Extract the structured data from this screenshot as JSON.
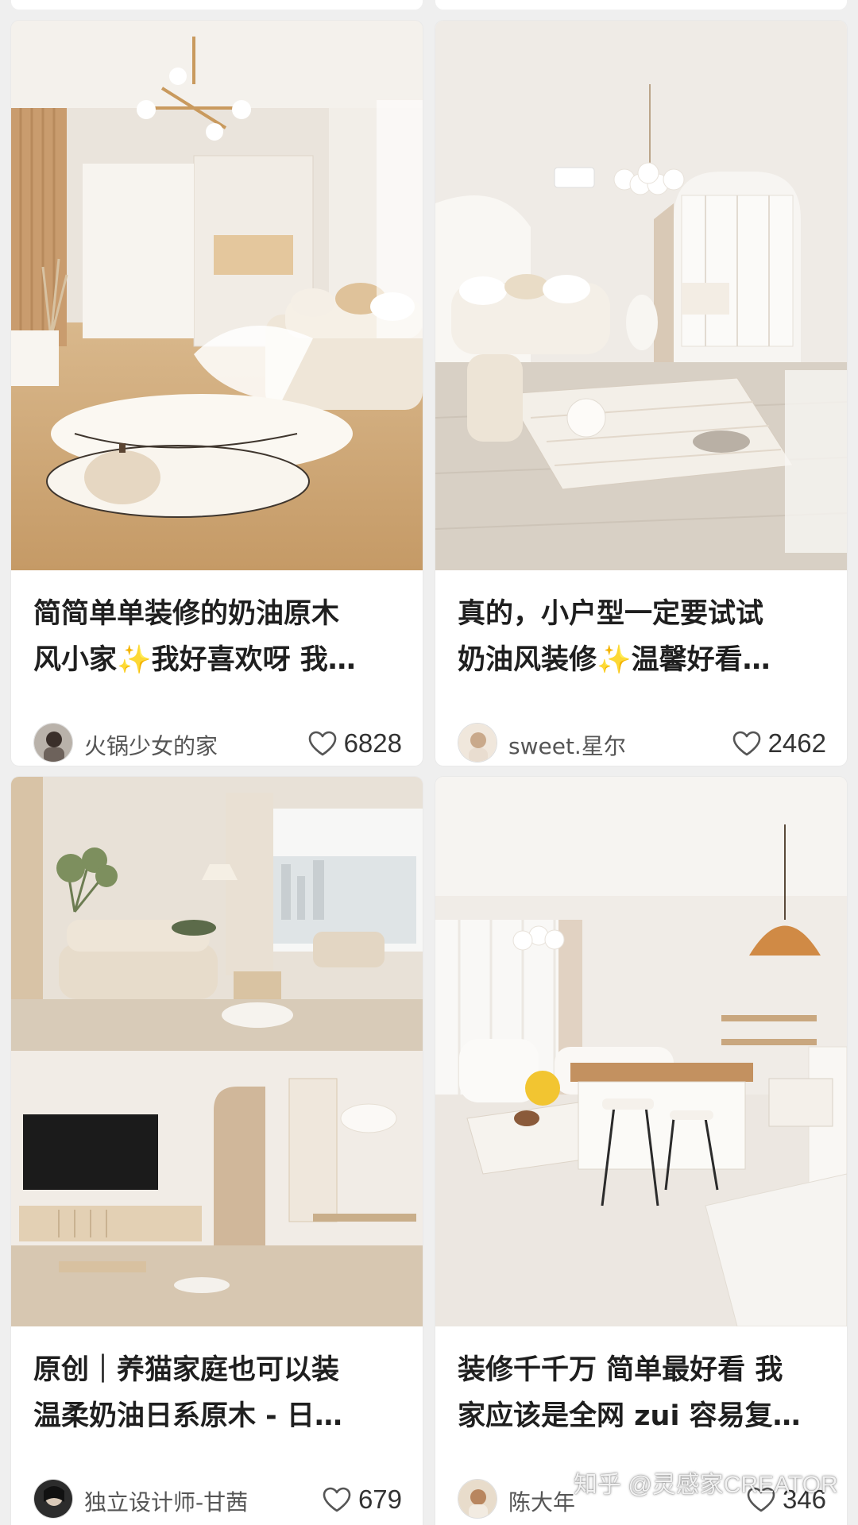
{
  "feed": {
    "cards": [
      {
        "title_line1": "简简单单装修的奶油原木",
        "title_line2": "风小家✨我好喜欢呀 我…",
        "author": "火锅少女的家",
        "likes": "6828"
      },
      {
        "title_line1": "真的，小户型一定要试试",
        "title_line2": "奶油风装修✨温馨好看…",
        "author": "sweet.星尔",
        "likes": "2462"
      },
      {
        "title_line1": "原创｜养猫家庭也可以装",
        "title_line2": "温柔奶油日系原木 - 日…",
        "author": "独立设计师-甘茜",
        "likes": "679"
      },
      {
        "title_line1": "装修千千万 简单最好看 我",
        "title_line2": "家应该是全网 zui 容易复…",
        "author": "陈大年",
        "likes": "346"
      }
    ]
  },
  "watermark": "知乎 @灵感家CREATOR",
  "colors": {
    "background": "#efefef",
    "card": "#ffffff",
    "title_text": "#1f1f1f",
    "meta_text": "#555555"
  },
  "icons": [
    "heart-icon"
  ]
}
